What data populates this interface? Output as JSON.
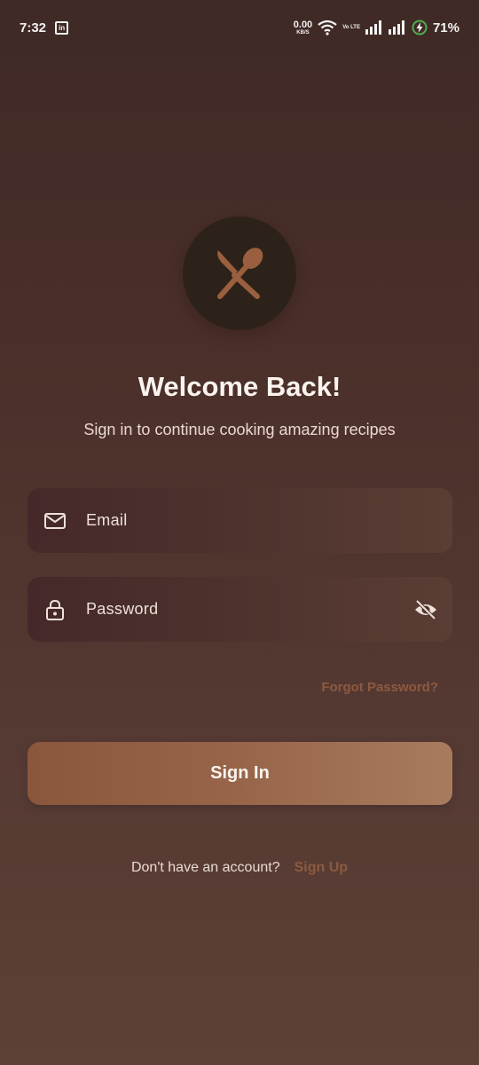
{
  "status_bar": {
    "time": "7:32",
    "app_icon": "linkedin-icon",
    "net_speed_value": "0.00",
    "net_speed_unit": "KB/S",
    "volte_label": "Vo LTE",
    "battery_percent": "71%",
    "icons": [
      "wifi-icon",
      "signal-icon",
      "signal-icon",
      "battery-charging-icon"
    ]
  },
  "logo": {
    "icon": "fork-spoon-icon",
    "accent": "#9a5f3f"
  },
  "heading": {
    "title": "Welcome Back!",
    "subtitle": "Sign in to continue cooking amazing recipes"
  },
  "form": {
    "email": {
      "label": "Email",
      "icon": "mail-icon"
    },
    "password": {
      "label": "Password",
      "icon": "lock-icon",
      "toggle_icon": "eye-off-icon"
    },
    "forgot_password": "Forgot Password?",
    "submit": "Sign In"
  },
  "footer": {
    "prompt": "Don't have an account?",
    "signup_link": "Sign Up"
  },
  "colors": {
    "background": "#4a2e29",
    "accent": "#8c5a3f",
    "button": "#98654a",
    "text": "#fbf4ee"
  }
}
